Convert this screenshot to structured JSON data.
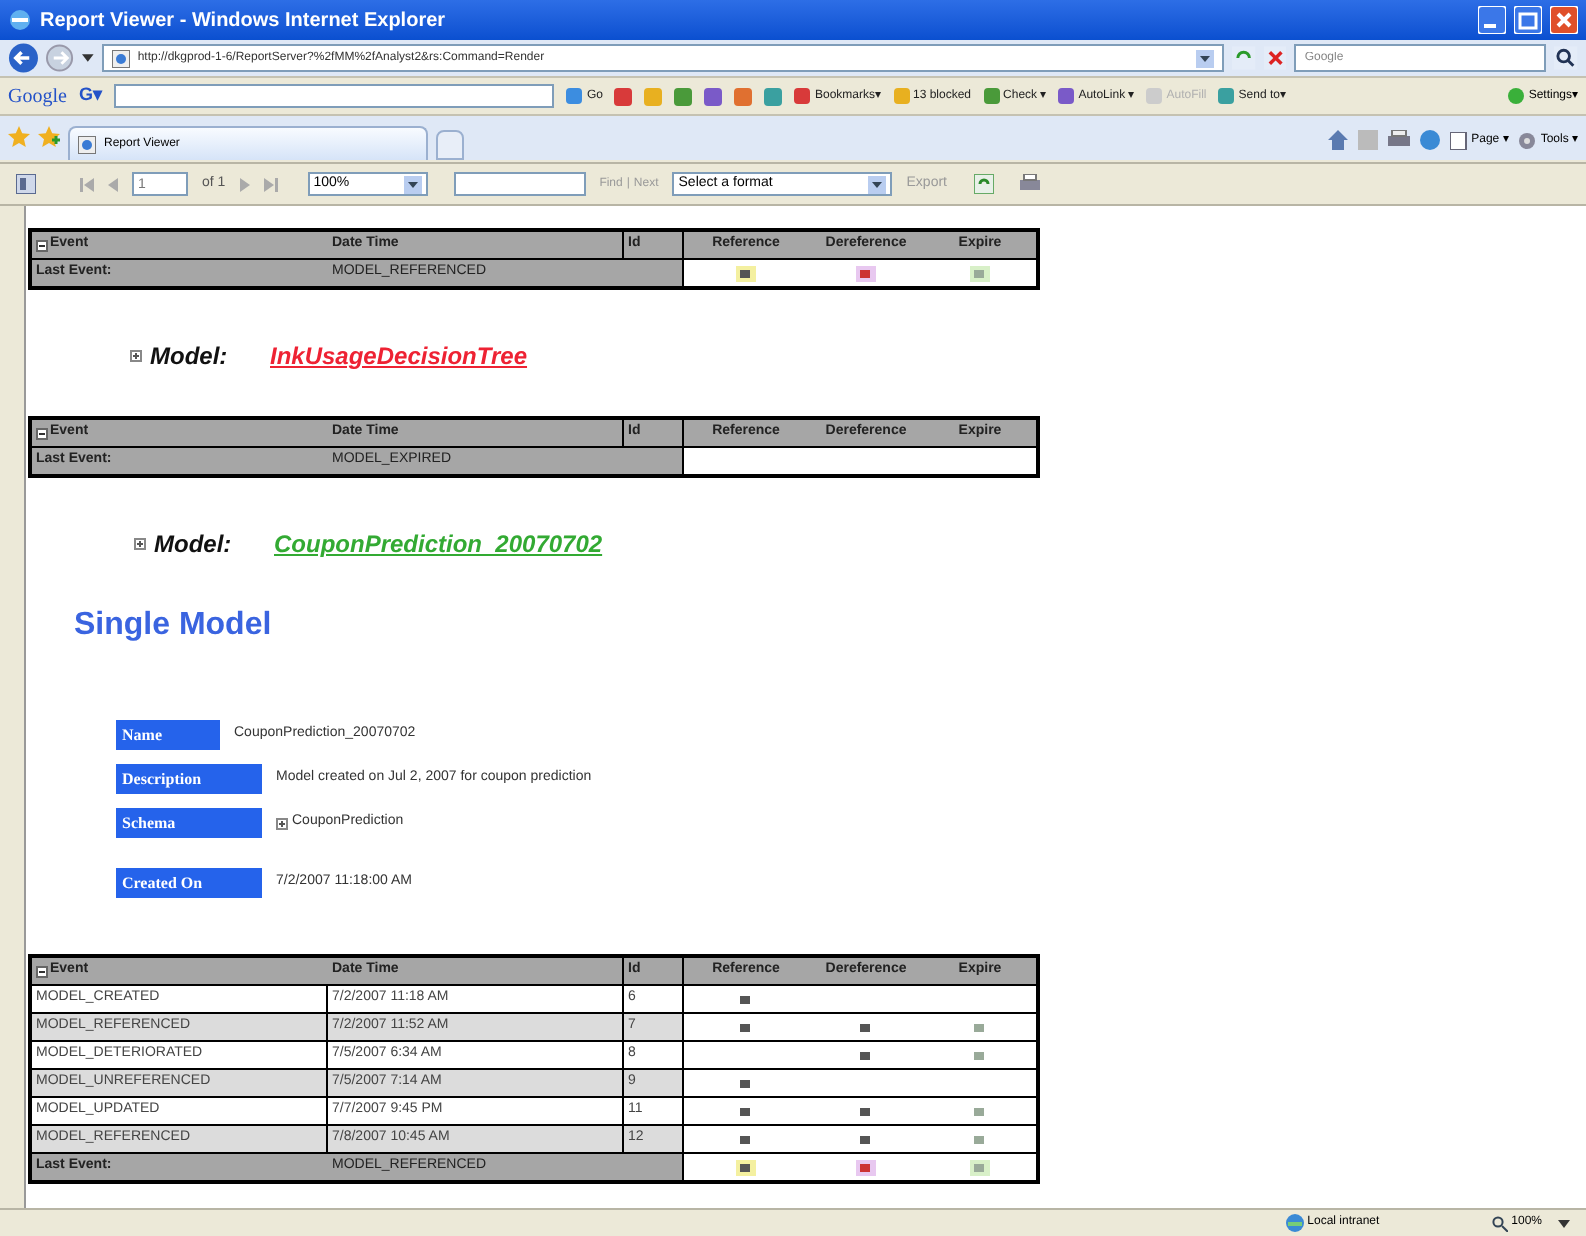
{
  "window": {
    "title": "Report Viewer - Windows Internet Explorer"
  },
  "address_bar": {
    "url": "http://dkgprod-1-6/ReportServer?%2fMM%2fAnalyst2&rs:Command=Render",
    "search_placeholder": "Google"
  },
  "google_toolbar": {
    "logo": "Google",
    "search_label": "G▾",
    "items": [
      {
        "label": "Go",
        "disabled": false
      },
      {
        "label": "Bookmarks▾",
        "disabled": false
      },
      {
        "label": "13 blocked",
        "disabled": false
      },
      {
        "label": "Check ▾",
        "disabled": false
      },
      {
        "label": "AutoLink ▾",
        "disabled": false
      },
      {
        "label": "AutoFill",
        "disabled": true
      },
      {
        "label": "Send to▾",
        "disabled": false
      }
    ],
    "settings": "Settings▾"
  },
  "tabs": [
    {
      "label": "Report Viewer",
      "selected": true
    }
  ],
  "command_bar": {
    "page": "Page ▾",
    "tools": "Tools ▾"
  },
  "report_toolbar": {
    "page": "1",
    "of_pages": "of 1",
    "zoom": "100%",
    "find": "Find",
    "separator": "|",
    "next": "Next",
    "format": "Select a format",
    "export": "Export"
  },
  "tables": [
    {
      "columns": [
        "Event",
        "Date Time",
        "Id",
        "Reference",
        "Dereference",
        "Expire"
      ],
      "rows": [
        {
          "kind": "last_event",
          "event": "Last Event:",
          "date_time": "MODEL_REFERENCED",
          "id": "",
          "reference": true,
          "dereference": true,
          "expire": true
        }
      ]
    },
    {
      "model": {
        "label": "Model:",
        "name": "InkUsageDecisionTree",
        "color": "#ee2233"
      },
      "columns": [
        "Event",
        "Date Time",
        "Id",
        "Reference",
        "Dereference",
        "Expire"
      ],
      "rows": [
        {
          "kind": "last_event",
          "event": "Last Event:",
          "date_time": "MODEL_EXPIRED",
          "id": "",
          "reference": false,
          "dereference": false,
          "expire": false
        }
      ]
    }
  ],
  "model": {
    "label": "Model:",
    "name": "CouponPrediction_20070702",
    "color": "#33aa33"
  },
  "single_model": {
    "title": "Single Model",
    "fields": [
      {
        "label": "Name",
        "value": "CouponPrediction_20070702",
        "icon": false
      },
      {
        "label": "Description",
        "value": "Model created on Jul 2, 2007 for coupon prediction",
        "icon": false
      },
      {
        "label": "Schema",
        "value": "CouponPrediction",
        "icon": true
      },
      {
        "label": "Created On",
        "value": "7/2/2007 11:18:00 AM",
        "icon": false
      }
    ]
  },
  "events_table": {
    "columns": [
      "Event",
      "Date Time",
      "Id",
      "Reference",
      "Dereference",
      "Expire"
    ],
    "rows": [
      {
        "kind": "event",
        "event": "MODEL_CREATED",
        "date_time": "7/2/2007 11:18 AM",
        "id": "6",
        "reference": true,
        "dereference": false,
        "expire": false
      },
      {
        "kind": "event",
        "event": "MODEL_REFERENCED",
        "date_time": "7/2/2007 11:52 AM",
        "id": "7",
        "reference": true,
        "dereference": true,
        "expire": true
      },
      {
        "kind": "event",
        "event": "MODEL_DETERIORATED",
        "date_time": "7/5/2007 6:34 AM",
        "id": "8",
        "reference": false,
        "dereference": true,
        "expire": true
      },
      {
        "kind": "event",
        "event": "MODEL_UNREFERENCED",
        "date_time": "7/5/2007 7:14 AM",
        "id": "9",
        "reference": true,
        "dereference": false,
        "expire": false
      },
      {
        "kind": "event",
        "event": "MODEL_UPDATED",
        "date_time": "7/7/2007 9:45 PM",
        "id": "11",
        "reference": true,
        "dereference": true,
        "expire": true
      },
      {
        "kind": "event",
        "event": "MODEL_REFERENCED",
        "date_time": "7/8/2007 10:45 AM",
        "id": "12",
        "reference": true,
        "dereference": true,
        "expire": true
      },
      {
        "kind": "last_event",
        "event": "Last Event:",
        "date_time": "MODEL_REFERENCED",
        "id": "",
        "reference": true,
        "dereference": true,
        "expire": true
      }
    ]
  },
  "status_bar": {
    "zone": "Local intranet",
    "zoom": "100%"
  }
}
